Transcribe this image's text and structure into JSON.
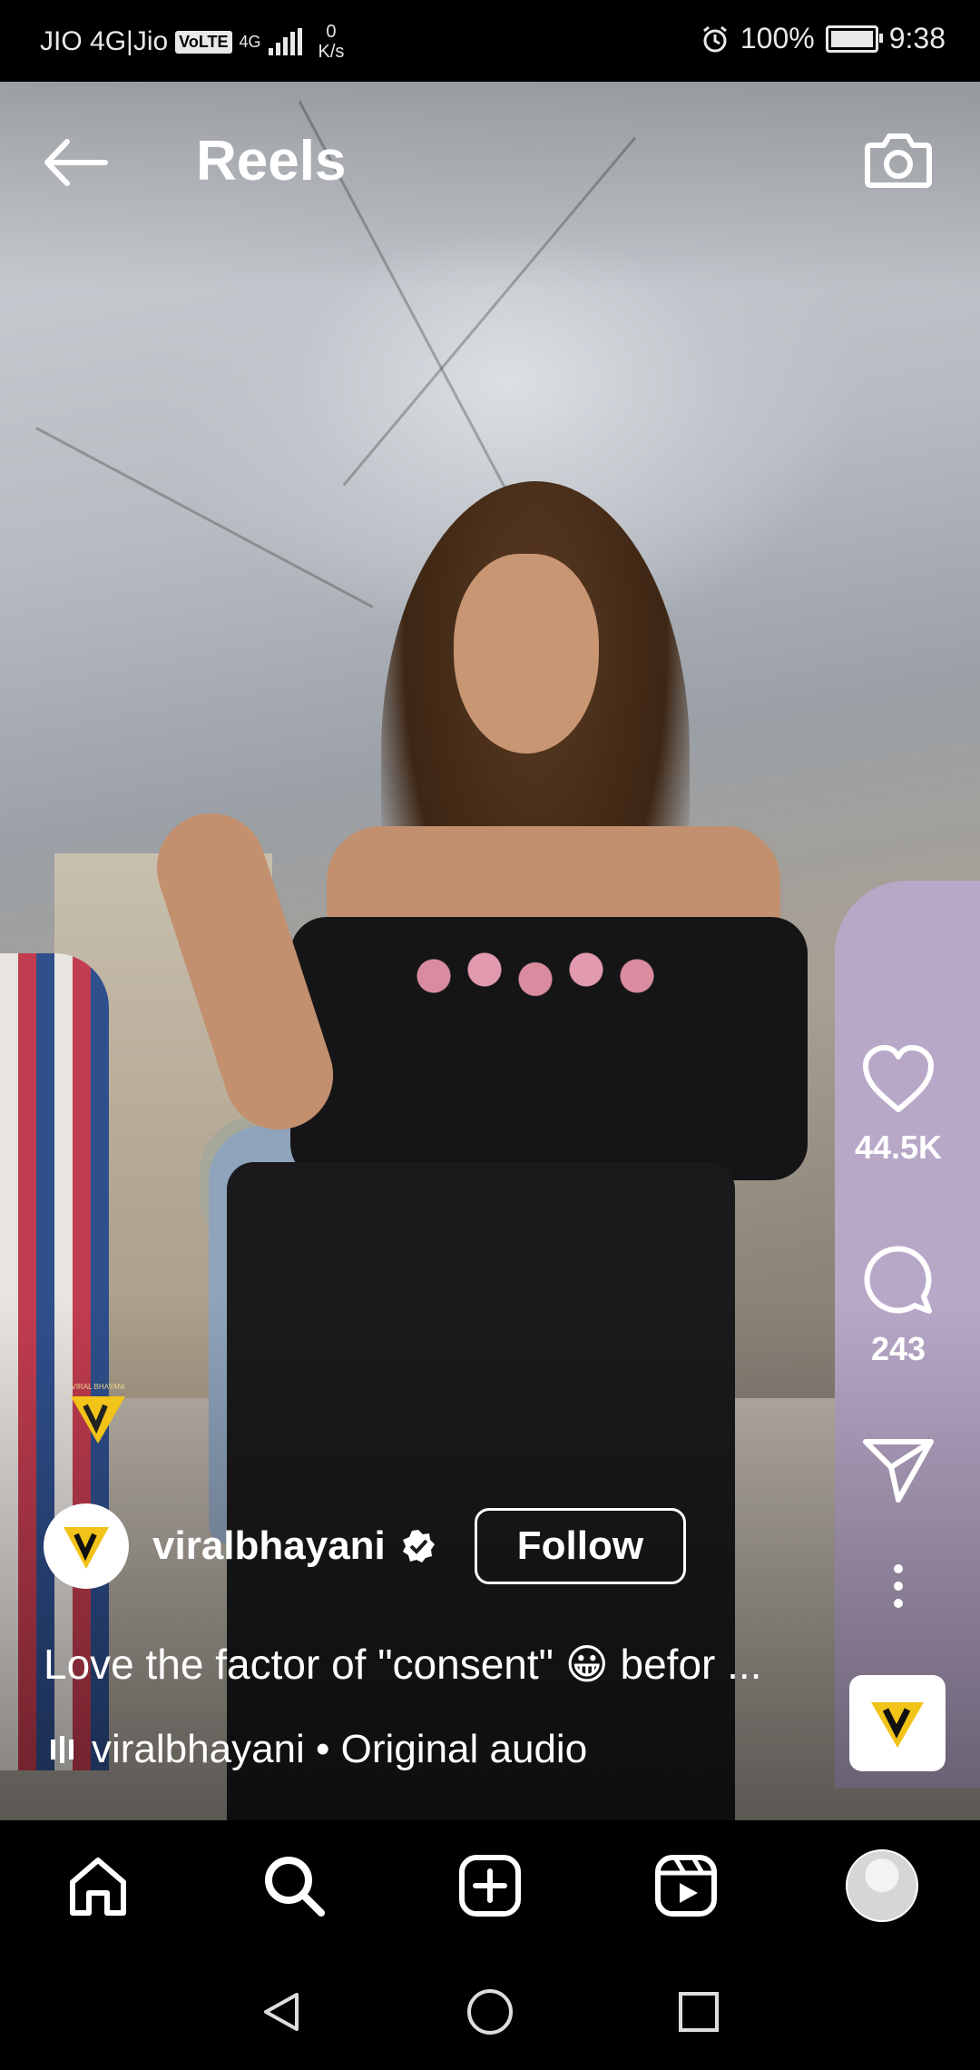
{
  "status_bar": {
    "carrier": "JIO 4G|Jio",
    "volte": "VoLTE",
    "network": "4G",
    "speed_value": "0",
    "speed_unit": "K/s",
    "battery": "100%",
    "time": "9:38"
  },
  "header": {
    "title": "Reels",
    "back_icon": "arrow-left-icon",
    "camera_icon": "camera-icon"
  },
  "actions": {
    "likes": "44.5K",
    "comments": "243",
    "like_icon": "heart-icon",
    "comment_icon": "comment-bubble-icon",
    "share_icon": "paper-plane-icon",
    "more_icon": "more-vertical-icon"
  },
  "post": {
    "username": "viralbhayani",
    "follow_label": "Follow",
    "caption": "Love the factor of \"consent\" 😀 befor ...",
    "audio_author": "viralbhayani",
    "audio_sep": " • ",
    "audio_title": "Original audio",
    "watermark_text": "VIRAL BHAYANI"
  },
  "bottom_nav": {
    "items": [
      "home-icon",
      "search-icon",
      "create-icon",
      "reels-icon",
      "profile-avatar"
    ]
  },
  "colors": {
    "background": "#000000",
    "text": "#ffffff",
    "brand_yellow": "#f2c318"
  }
}
